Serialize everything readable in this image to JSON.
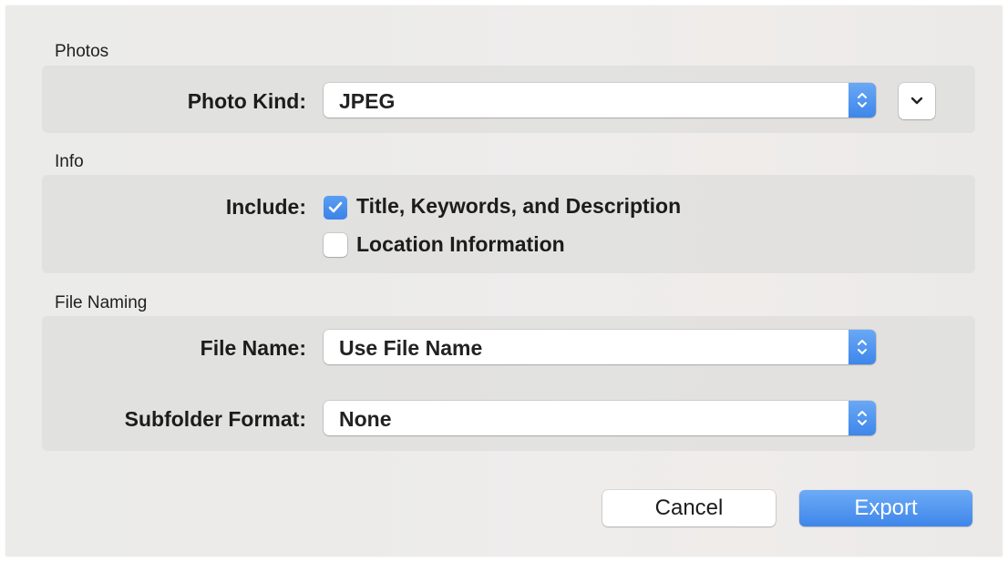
{
  "sections": {
    "photos": {
      "heading": "Photos",
      "photo_kind_label": "Photo Kind:",
      "photo_kind_value": "JPEG"
    },
    "info": {
      "heading": "Info",
      "include_label": "Include:",
      "options": [
        {
          "label": "Title, Keywords, and Description",
          "checked": true
        },
        {
          "label": "Location Information",
          "checked": false
        }
      ]
    },
    "file_naming": {
      "heading": "File Naming",
      "file_name_label": "File Name:",
      "file_name_value": "Use File Name",
      "subfolder_label": "Subfolder Format:",
      "subfolder_value": "None"
    }
  },
  "buttons": {
    "cancel": "Cancel",
    "export": "Export"
  },
  "icons": {
    "popup_stepper": "up-down-chevrons-icon",
    "disclosure": "chevron-down-icon",
    "checkmark": "checkmark-icon"
  },
  "colors": {
    "accent": "#3d86ea",
    "accent_light": "#6aa8f5",
    "panel": "#ebeae9",
    "group": "#dedddc"
  }
}
